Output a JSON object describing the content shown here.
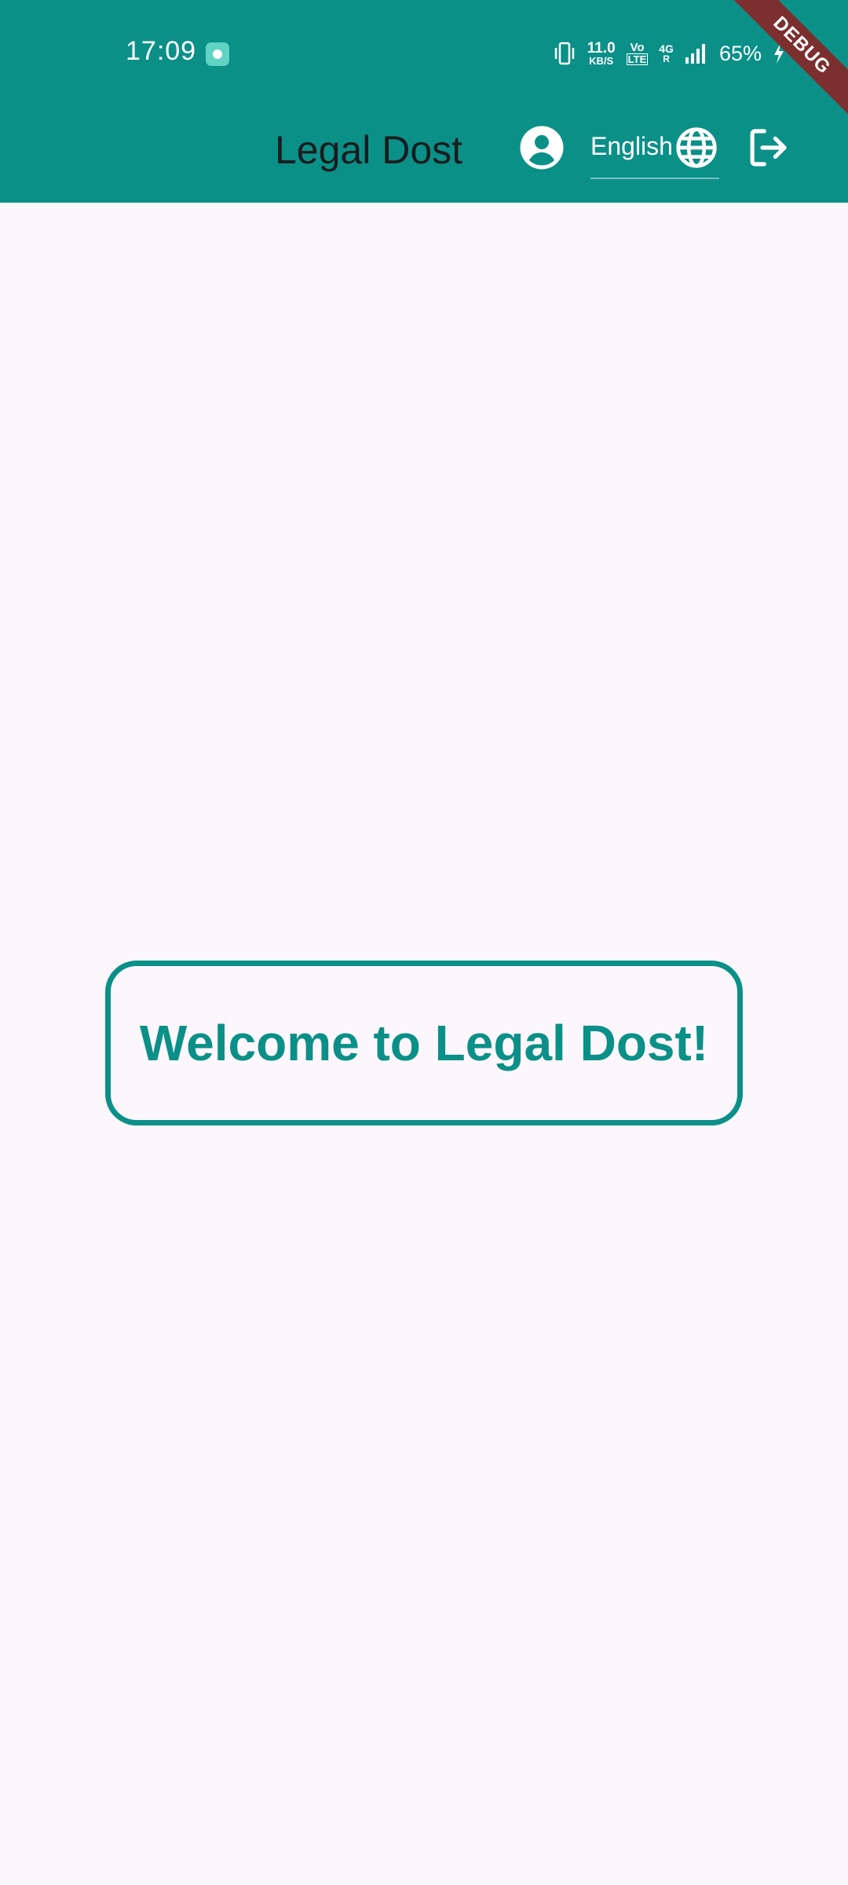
{
  "status_bar": {
    "time": "17:09",
    "net_speed_value": "11.0",
    "net_speed_unit": "KB/S",
    "volte_top": "Vo",
    "volte_bottom": "LTE",
    "network_type_top": "4G",
    "network_type_bottom": "R",
    "battery": "65%",
    "icons": [
      "app-notification-icon",
      "vibrate-icon",
      "signal-icon",
      "charging-bolt-icon"
    ]
  },
  "debug_banner": "DEBUG",
  "app_bar": {
    "title": "Legal Dost",
    "language_selected": "English",
    "icons": [
      "account-circle-icon",
      "globe-icon",
      "logout-icon"
    ]
  },
  "main": {
    "welcome_message": "Welcome to Legal Dost!"
  },
  "colors": {
    "primary": "#0B9088",
    "background": "#FCF6FD",
    "title_text": "#1A1C1E",
    "debug_ribbon": "#7B2F2E"
  }
}
